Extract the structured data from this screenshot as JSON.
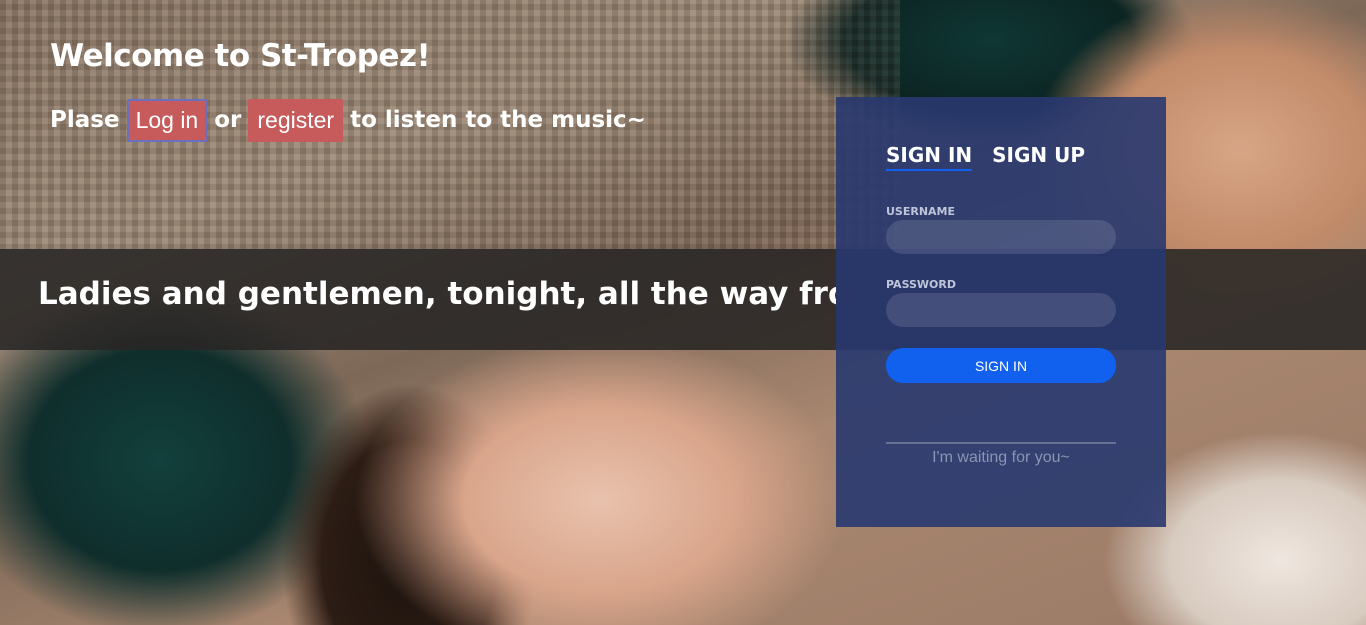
{
  "header": {
    "title": "Welcome to St-Tropez!",
    "prompt_prefix": "Plase",
    "login_label": "Log in",
    "connector": "or",
    "register_label": "register",
    "prompt_suffix": "to listen to the music~"
  },
  "banner": {
    "text": "Ladies and gentlemen, tonight, all the way from Mo"
  },
  "login_panel": {
    "tabs": [
      {
        "label": "SIGN IN",
        "active": true
      },
      {
        "label": "SIGN UP",
        "active": false
      }
    ],
    "username_label": "USERNAME",
    "username_value": "",
    "password_label": "PASSWORD",
    "password_value": "",
    "submit_label": "SIGN IN",
    "footer_text": "I'm waiting for you~"
  },
  "colors": {
    "panel_bg": "#28396f",
    "accent": "#1161ee",
    "pill": "#c75a5a"
  }
}
